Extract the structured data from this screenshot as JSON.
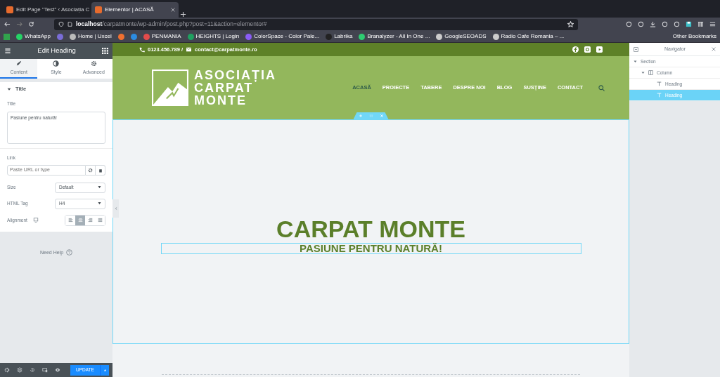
{
  "browser": {
    "tabs": [
      {
        "title": "Edit Page \"Test\" ‹ Asociația C",
        "selected": false
      },
      {
        "title": "Elementor | ACASĂ",
        "selected": true
      }
    ],
    "url": {
      "host": "localhost",
      "path": "/carpatmonte/wp-admin/post.php?post=11&action=elementor#"
    },
    "bookmarks": [
      {
        "label": "WhatsApp",
        "color": "#25d366"
      },
      {
        "color": "#7a6dd8"
      },
      {
        "label": "Home | Uxcel",
        "color": "#bbbbbb"
      },
      {
        "color": "#f07030"
      },
      {
        "color": "#2b8be0"
      },
      {
        "label": "PENMANIA",
        "color": "#e34b4b"
      },
      {
        "label": "HEIGHTS | Login",
        "color": "#1fa060"
      },
      {
        "label": "ColorSpace - Color Pale...",
        "color": "#8a5cf6"
      },
      {
        "label": "Labrika",
        "color": "#222222"
      },
      {
        "label": "Branalyzer - All In One ...",
        "color": "#2ecc71"
      },
      {
        "label": "GoogleSEOADS",
        "color": "#cccccc"
      },
      {
        "label": "Radio Cafe Romania – ...",
        "color": "#cccccc"
      }
    ],
    "other_bookmarks": "Other Bookmarks"
  },
  "editor_panel": {
    "title": "Edit Heading",
    "tabs": [
      {
        "label": "Content",
        "selected": true
      },
      {
        "label": "Style",
        "selected": false
      },
      {
        "label": "Advanced",
        "selected": false
      }
    ],
    "section": {
      "title": "Title",
      "expanded": true
    },
    "title_field": {
      "label": "Title",
      "value": "Pasiune pentru natură!"
    },
    "link_field": {
      "label": "Link",
      "placeholder": "Paste URL or type"
    },
    "size": {
      "label": "Size",
      "value": "Default"
    },
    "html_tag": {
      "label": "HTML Tag",
      "value": "H4"
    },
    "alignment": {
      "label": "Alignment",
      "options": [
        {
          "selected": false
        },
        {
          "selected": true
        },
        {
          "selected": false
        },
        {
          "selected": false
        }
      ]
    },
    "need_help": "Need Help",
    "update_button": "UPDATE"
  },
  "page": {
    "phone": "0123.456.789 /",
    "email": "contact@carpatmonte.ro",
    "logo_lines": [
      "ASOCIAȚIA",
      "CARPAT",
      "MONTE"
    ],
    "nav": [
      {
        "label": "ACASĂ",
        "selected": true
      },
      {
        "label": "PROIECTE",
        "selected": false
      },
      {
        "label": "TABERE",
        "selected": false
      },
      {
        "label": "DESPRE NOI",
        "selected": false
      },
      {
        "label": "BLOG",
        "selected": false
      },
      {
        "label": "SUSȚINE",
        "selected": false
      },
      {
        "label": "CONTACT",
        "selected": false
      }
    ],
    "heading": "CARPAT MONTE",
    "subheading": "PASIUNE PENTRU NATURĂ!"
  },
  "navigator": {
    "title": "Navigator",
    "tree": [
      {
        "label": "Section",
        "expanded": true,
        "selected": false,
        "children": [
          {
            "label": "Column",
            "expanded": true,
            "selected": false,
            "children": [
              {
                "label": "Heading",
                "selected": false
              },
              {
                "label": "Heading",
                "selected": true
              }
            ]
          }
        ]
      }
    ]
  }
}
